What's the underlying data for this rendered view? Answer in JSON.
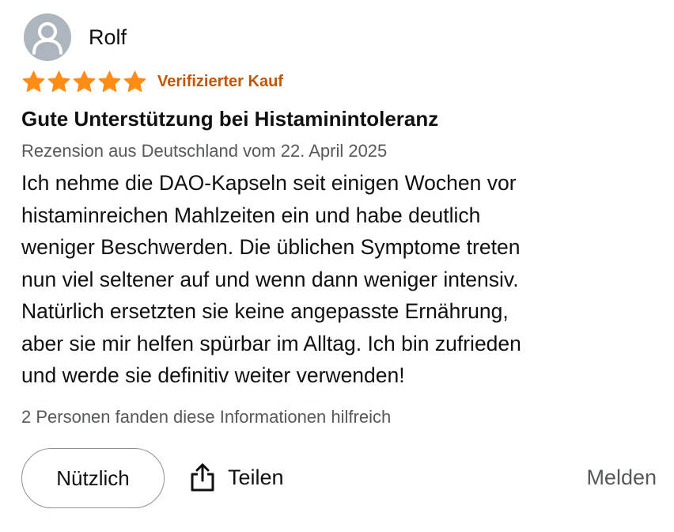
{
  "review": {
    "author": "Rolf",
    "rating": 5,
    "rating_max": 5,
    "verified_label": "Verifizierter Kauf",
    "title": "Gute Unterstützung bei Histaminintoleranz",
    "meta": "Rezension aus Deutschland vom 22. April 2025",
    "body_lines": [
      "Ich nehme die DAO-Kapseln seit einigen Wochen vor",
      "histaminreichen Mahlzeiten ein und habe deutlich",
      "weniger Beschwerden. Die üblichen Symptome treten",
      "nun viel seltener auf und wenn dann weniger intensiv.",
      "Natürlich ersetzten sie keine angepasste Ernährung,",
      "aber sie mir helfen spürbar im Alltag. Ich bin zufrieden",
      "und werde sie definitiv weiter verwenden!"
    ],
    "helpful_text": "2 Personen fanden diese Informationen hilfreich"
  },
  "actions": {
    "helpful_label": "Nützlich",
    "share_label": "Teilen",
    "report_label": "Melden"
  },
  "icons": {
    "avatar": "user-silhouette-icon",
    "star": "star-icon",
    "share": "share-upload-icon"
  },
  "colors": {
    "star": "#ff8c14",
    "verified": "#c45500",
    "secondary_text": "#565959",
    "avatar_bg": "#adb5bd",
    "button_border": "#8d9096"
  }
}
